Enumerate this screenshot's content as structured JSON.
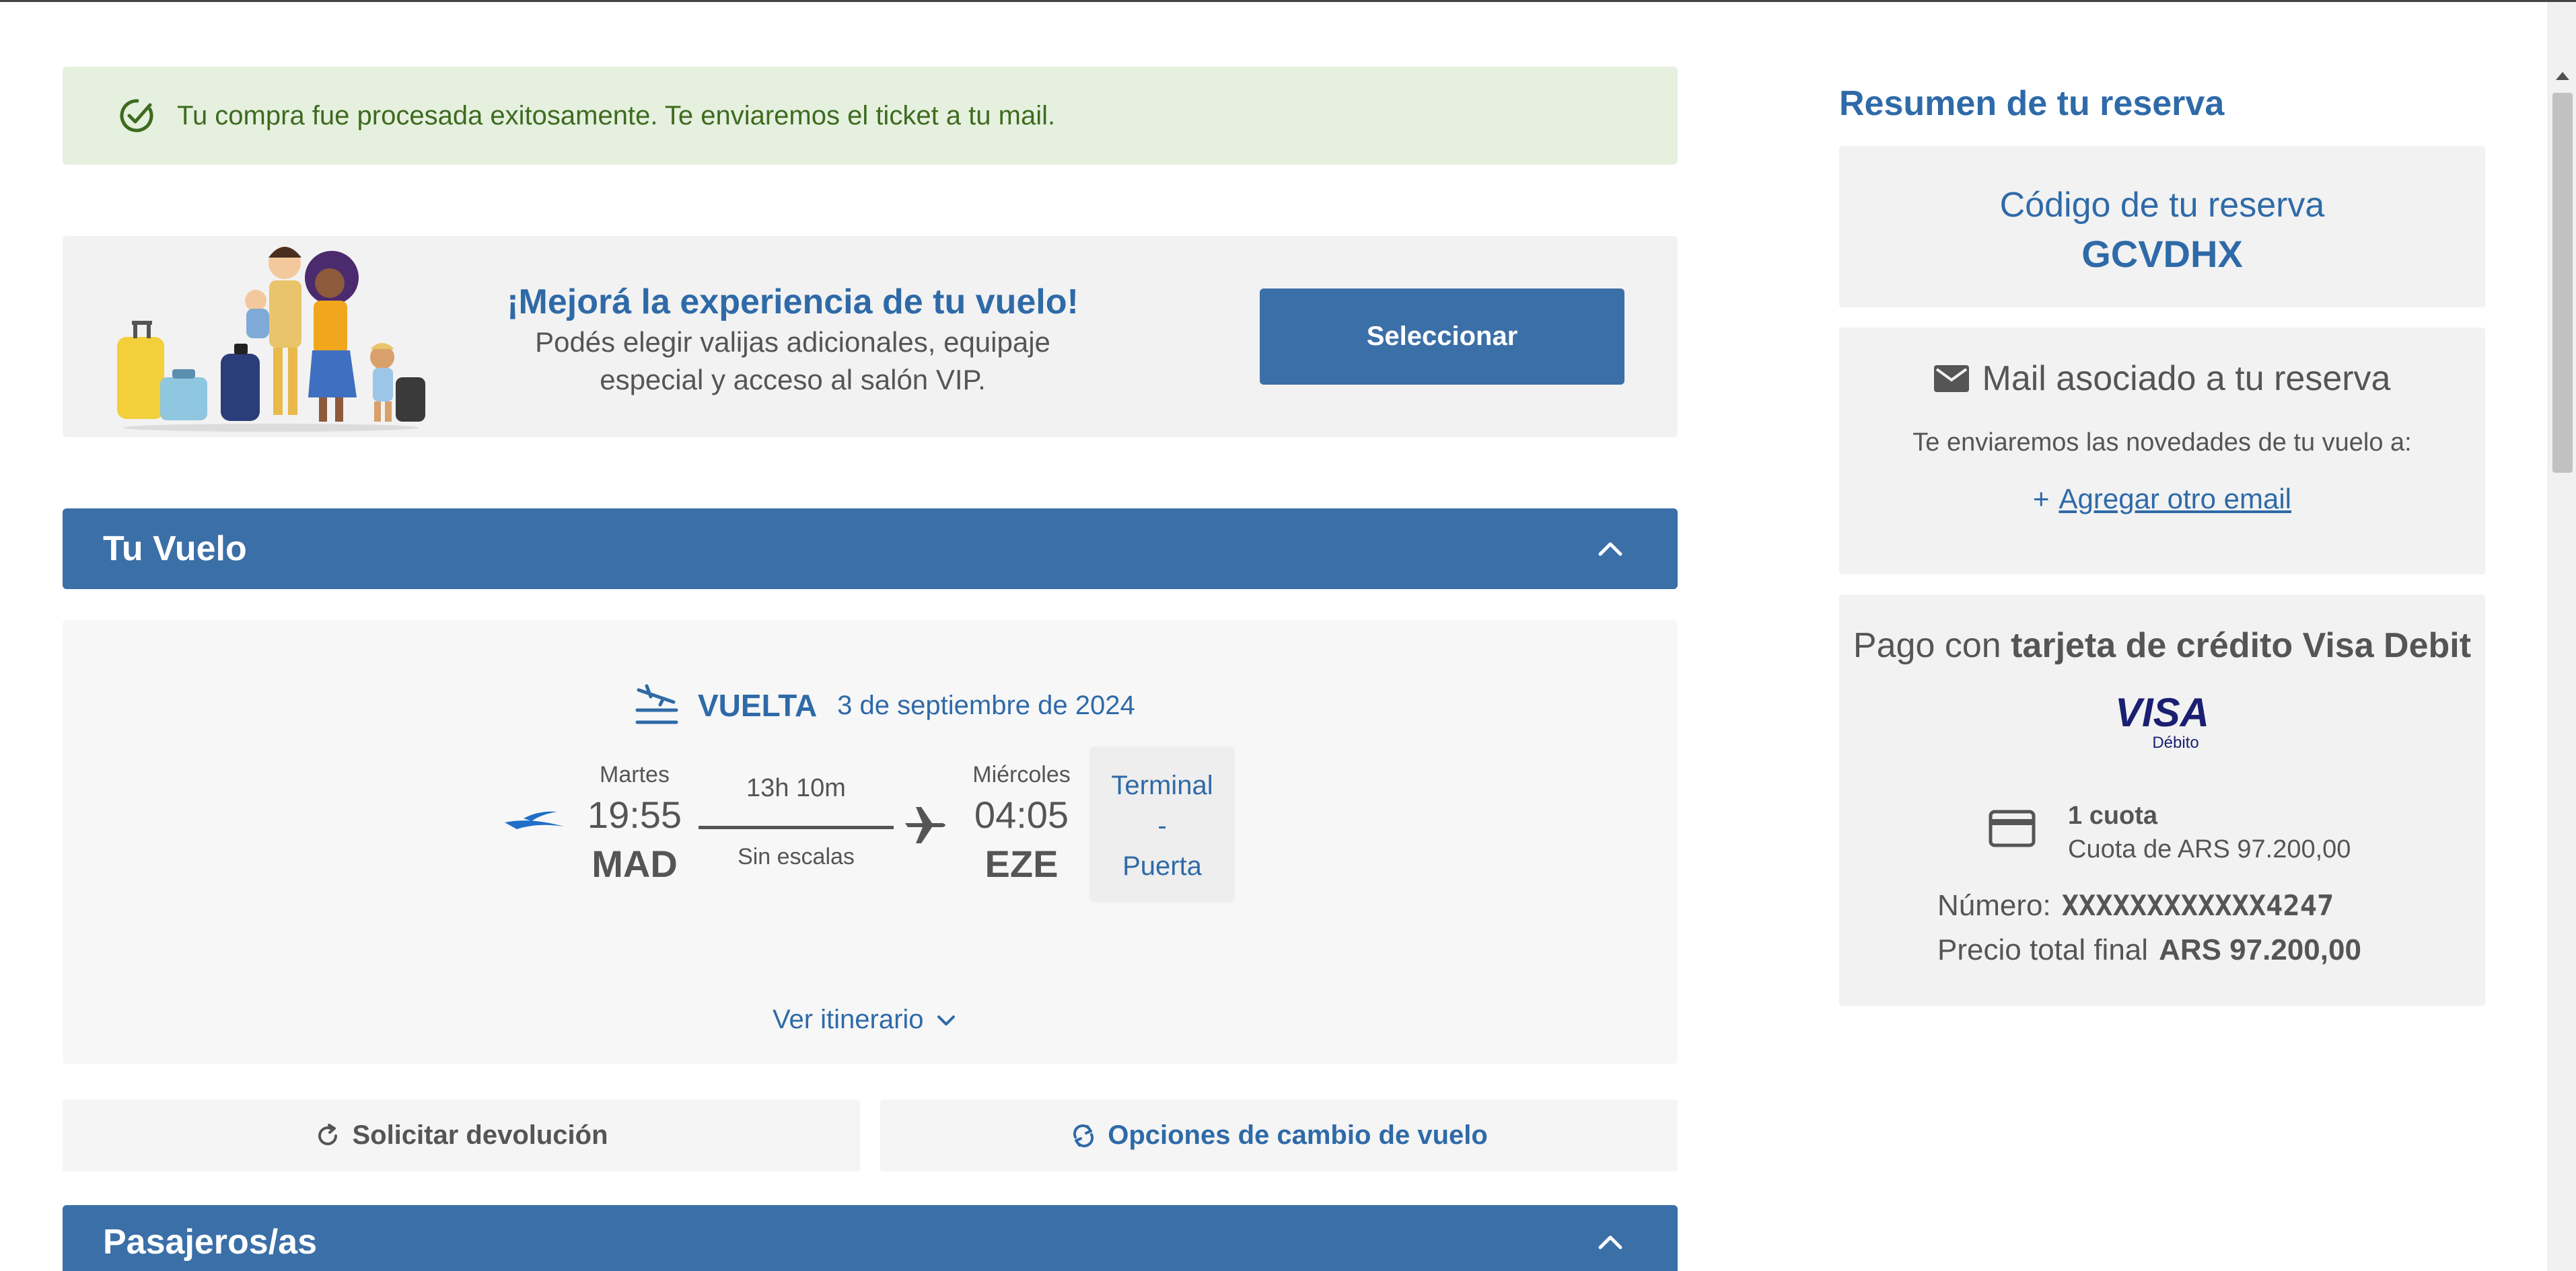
{
  "alert": {
    "message": "Tu compra fue procesada exitosamente. Te enviaremos el ticket a tu mail."
  },
  "promo": {
    "title": "¡Mejorá la experiencia de tu vuelo!",
    "subtitle_line1": "Podés elegir valijas adicionales, equipaje",
    "subtitle_line2": "especial y acceso al salón VIP.",
    "button_label": "Seleccionar"
  },
  "flight_section": {
    "title": "Tu Vuelo",
    "leg": {
      "label": "VUELTA",
      "date": "3 de septiembre de 2024",
      "departure": {
        "day": "Martes",
        "time": "19:55",
        "airport": "MAD"
      },
      "duration": "13h 10m",
      "stops": "Sin escalas",
      "arrival": {
        "day": "Miércoles",
        "time": "04:05",
        "airport": "EZE"
      },
      "terminal_label": "Terminal",
      "terminal_value": "-",
      "gate_label": "Puerta"
    },
    "itinerary_link": "Ver itinerario"
  },
  "actions": {
    "refund_label": "Solicitar devolución",
    "change_label": "Opciones de cambio de vuelo"
  },
  "passengers_section": {
    "title": "Pasajeros/as"
  },
  "summary": {
    "title": "Resumen de tu reserva",
    "code_label": "Código de tu reserva",
    "code_value": "GCVDHX",
    "mail_title": "Mail asociado a tu reserva",
    "mail_sub": "Te enviaremos las novedades de tu vuelo a:",
    "add_email_plus": "+",
    "add_email_label": "Agregar otro email",
    "payment_prefix": "Pago con ",
    "payment_method": "tarjeta de crédito Visa Debit",
    "visa_brand": "VISA",
    "visa_sub": "Débito",
    "installments_title": "1 cuota",
    "installments_detail": "Cuota de ARS 97.200,00",
    "card_number_label": "Número:",
    "card_number_value": "XXXXXXXXXXXX4247",
    "total_label": "Precio total final",
    "total_value": "ARS 97.200,00"
  },
  "colors": {
    "brand_blue": "#3b6fa8",
    "link_blue": "#2f6aa8",
    "success_bg": "#e6f0df",
    "success_text": "#3d6b1f"
  },
  "icons": [
    "check-circle-icon",
    "flight-return-icon",
    "airline-logo",
    "airplane-icon",
    "chevron-up-icon",
    "chevron-down-icon",
    "refund-icon",
    "change-icon",
    "mail-icon",
    "credit-card-icon"
  ]
}
